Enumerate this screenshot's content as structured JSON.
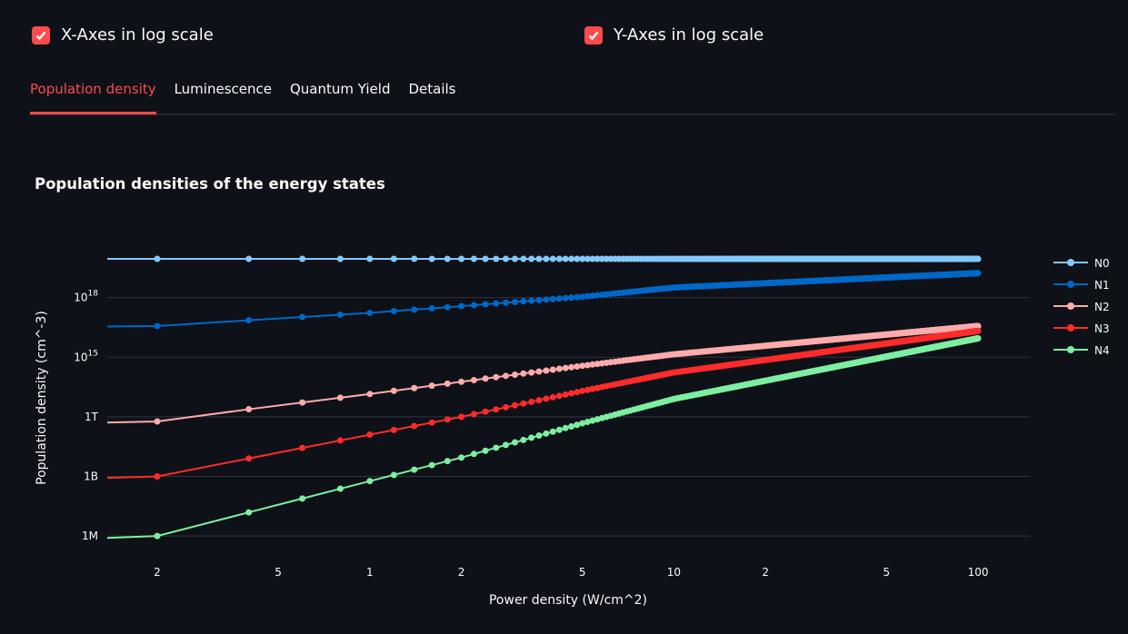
{
  "controls": {
    "x_log": {
      "label": "X-Axes in log scale",
      "checked": true
    },
    "y_log": {
      "label": "Y-Axes in log scale",
      "checked": true
    }
  },
  "tabs": [
    {
      "label": "Population density",
      "active": true
    },
    {
      "label": "Luminescence"
    },
    {
      "label": "Quantum Yield"
    },
    {
      "label": "Details"
    }
  ],
  "colors": {
    "accent": "#ff4b4b",
    "background": "#0e1117"
  },
  "chart_data": {
    "type": "line",
    "title": "Population densities of the energy states",
    "xlabel": "Power density (W/cm^2)",
    "ylabel": "Population density (cm^-3)",
    "x_scale": "log",
    "y_scale": "log",
    "xlim": [
      0.137,
      148
    ],
    "ylim": [
      100000.0,
      1e+21
    ],
    "x_ticks": [
      {
        "v": 0.2,
        "label": "2"
      },
      {
        "v": 0.5,
        "label": "5"
      },
      {
        "v": 1,
        "label": "1"
      },
      {
        "v": 2,
        "label": "2"
      },
      {
        "v": 5,
        "label": "5"
      },
      {
        "v": 10,
        "label": "10"
      },
      {
        "v": 20,
        "label": "2"
      },
      {
        "v": 50,
        "label": "5"
      },
      {
        "v": 100,
        "label": "100"
      }
    ],
    "y_ticks": [
      {
        "v": 1000000.0,
        "label": "1M"
      },
      {
        "v": 1000000000.0,
        "label": "1B"
      },
      {
        "v": 1000000000000.0,
        "label": "1T"
      },
      {
        "v": 1000000000000000.0,
        "label": "10",
        "sup": "15"
      },
      {
        "v": 1e+18,
        "label": "10",
        "sup": "18"
      }
    ],
    "grid": true,
    "legend": "right",
    "mode": "lines+markers",
    "x": {
      "start": 0.2,
      "step": 0.2,
      "end": 100
    },
    "anchor_x": [
      0.2,
      0.4,
      1,
      2,
      5,
      10,
      100
    ],
    "series": [
      {
        "name": "N0",
        "color": "#83c9ff",
        "values": [
          8.9e+19,
          8.9e+19,
          8.9e+19,
          8.9e+19,
          8.9e+19,
          8.9e+19,
          8.9e+19
        ]
      },
      {
        "name": "N1",
        "color": "#0068c9",
        "values": [
          3.7e+16,
          7.2e+16,
          1.7e+17,
          3.7e+17,
          1.1e+18,
          3.2e+18,
          1.7e+19
        ]
      },
      {
        "name": "N2",
        "color": "#ffabab",
        "values": [
          580000000000.0,
          2400000000000.0,
          14000000000000.0,
          58000000000000.0,
          370000000000000.0,
          1400000000000000.0,
          3.7e+16
        ]
      },
      {
        "name": "N3",
        "color": "#ff2b2b",
        "values": [
          1000000000.0,
          8000000000.0,
          126000000000.0,
          1000000000000.0,
          20000000000000.0,
          170000000000000.0,
          2.1e+16
        ]
      },
      {
        "name": "N4",
        "color": "#7defa1",
        "values": [
          1000000.0,
          15500000.0,
          580000000.0,
          8900000000.0,
          470000000000.0,
          7900000000000.0,
          8900000000000000.0
        ]
      }
    ]
  }
}
